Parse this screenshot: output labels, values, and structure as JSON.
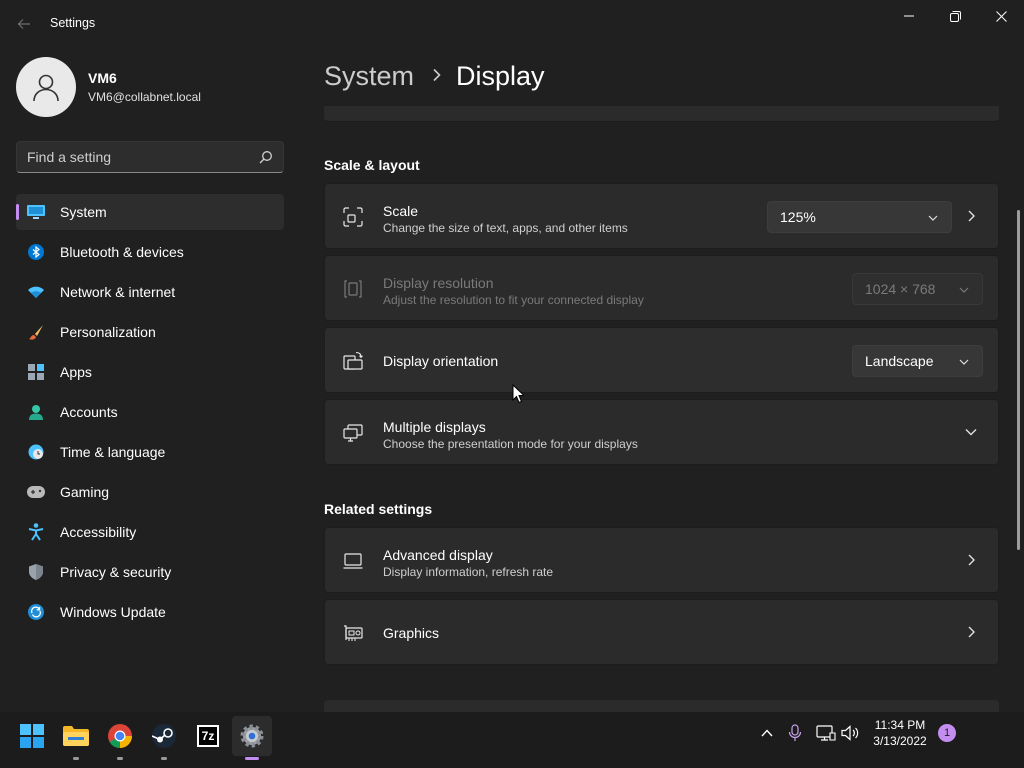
{
  "window": {
    "title": "Settings"
  },
  "profile": {
    "name": "VM6",
    "email": "VM6@collabnet.local"
  },
  "search": {
    "placeholder": "Find a setting"
  },
  "sidebar": {
    "items": [
      {
        "label": "System",
        "icon": "system-icon",
        "active": true
      },
      {
        "label": "Bluetooth & devices",
        "icon": "bluetooth-icon"
      },
      {
        "label": "Network & internet",
        "icon": "wifi-icon"
      },
      {
        "label": "Personalization",
        "icon": "brush-icon"
      },
      {
        "label": "Apps",
        "icon": "apps-icon"
      },
      {
        "label": "Accounts",
        "icon": "account-icon"
      },
      {
        "label": "Time & language",
        "icon": "clock-globe-icon"
      },
      {
        "label": "Gaming",
        "icon": "gamepad-icon"
      },
      {
        "label": "Accessibility",
        "icon": "accessibility-icon"
      },
      {
        "label": "Privacy & security",
        "icon": "shield-icon"
      },
      {
        "label": "Windows Update",
        "icon": "update-icon"
      }
    ]
  },
  "breadcrumb": {
    "parent": "System",
    "current": "Display"
  },
  "scale_layout": {
    "heading": "Scale & layout",
    "scale": {
      "title": "Scale",
      "subtitle": "Change the size of text, apps, and other items",
      "value": "125%"
    },
    "resolution": {
      "title": "Display resolution",
      "subtitle": "Adjust the resolution to fit your connected display",
      "value": "1024 × 768",
      "disabled": true
    },
    "orientation": {
      "title": "Display orientation",
      "value": "Landscape"
    },
    "multiple": {
      "title": "Multiple displays",
      "subtitle": "Choose the presentation mode for your displays"
    }
  },
  "related": {
    "heading": "Related settings",
    "advanced": {
      "title": "Advanced display",
      "subtitle": "Display information, refresh rate"
    },
    "graphics": {
      "title": "Graphics"
    }
  },
  "taskbar": {
    "apps": [
      "start-icon",
      "file-explorer-icon",
      "chrome-icon",
      "steam-icon",
      "7zip-icon",
      "settings-icon"
    ],
    "sevenzip_label": "7z",
    "time": "11:34 PM",
    "date": "3/13/2022",
    "notifications": "1"
  },
  "colors": {
    "accent": "#c48df0",
    "background": "#202020",
    "card": "#2b2b2b"
  }
}
